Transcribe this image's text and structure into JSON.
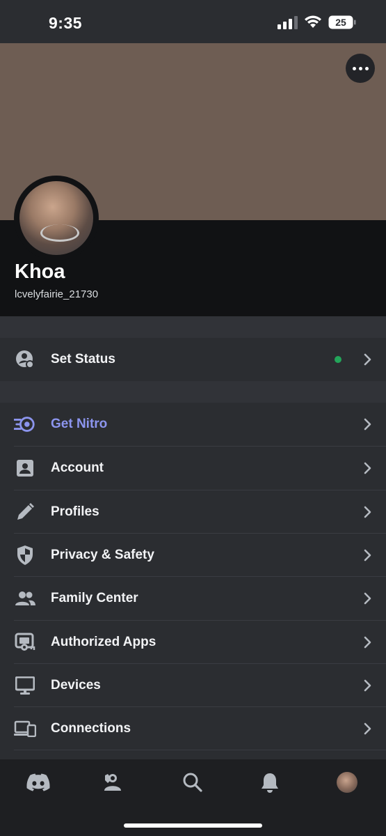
{
  "status_bar": {
    "time": "9:35",
    "battery": "25"
  },
  "profile": {
    "display_name": "Khoa",
    "username": "lcvelyfairie_21730"
  },
  "status_row": {
    "label": "Set Status",
    "status_color": "#23a55a"
  },
  "menu": [
    {
      "id": "get-nitro",
      "label": "Get Nitro",
      "icon": "nitro-icon"
    },
    {
      "id": "account",
      "label": "Account",
      "icon": "account-icon"
    },
    {
      "id": "profiles",
      "label": "Profiles",
      "icon": "pencil-icon"
    },
    {
      "id": "privacy-safety",
      "label": "Privacy & Safety",
      "icon": "shield-icon"
    },
    {
      "id": "family-center",
      "label": "Family Center",
      "icon": "people-icon"
    },
    {
      "id": "authorized-apps",
      "label": "Authorized Apps",
      "icon": "apps-key-icon"
    },
    {
      "id": "devices",
      "label": "Devices",
      "icon": "monitor-icon"
    },
    {
      "id": "connections",
      "label": "Connections",
      "icon": "devices-icon"
    }
  ],
  "tabs": [
    {
      "id": "home",
      "icon": "discord-icon"
    },
    {
      "id": "friends",
      "icon": "friends-icon"
    },
    {
      "id": "search",
      "icon": "search-icon"
    },
    {
      "id": "notifications",
      "icon": "bell-icon"
    },
    {
      "id": "you",
      "icon": "avatar"
    }
  ],
  "colors": {
    "accent": "#8c95ee",
    "banner": "#6e5d53",
    "online": "#23a55a"
  }
}
